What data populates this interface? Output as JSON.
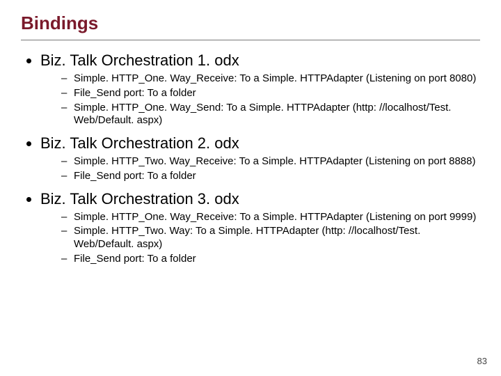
{
  "title": "Bindings",
  "sections": [
    {
      "heading": "Biz. Talk Orchestration 1. odx",
      "items": [
        "Simple. HTTP_One. Way_Receive: To a Simple. HTTPAdapter (Listening on port 8080)",
        "File_Send port: To a folder",
        "Simple. HTTP_One. Way_Send: To a Simple. HTTPAdapter (http: //localhost/Test. Web/Default. aspx)"
      ]
    },
    {
      "heading": "Biz. Talk Orchestration 2. odx",
      "items": [
        "Simple. HTTP_Two. Way_Receive: To a Simple. HTTPAdapter (Listening on port 8888)",
        "File_Send port: To a folder"
      ]
    },
    {
      "heading": "Biz. Talk Orchestration 3. odx",
      "items": [
        "Simple. HTTP_One. Way_Receive: To a Simple. HTTPAdapter (Listening on port 9999)",
        "Simple. HTTP_Two. Way: To a Simple. HTTPAdapter (http: //localhost/Test. Web/Default. aspx)",
        "File_Send port: To a folder"
      ]
    }
  ],
  "page_number": "83"
}
